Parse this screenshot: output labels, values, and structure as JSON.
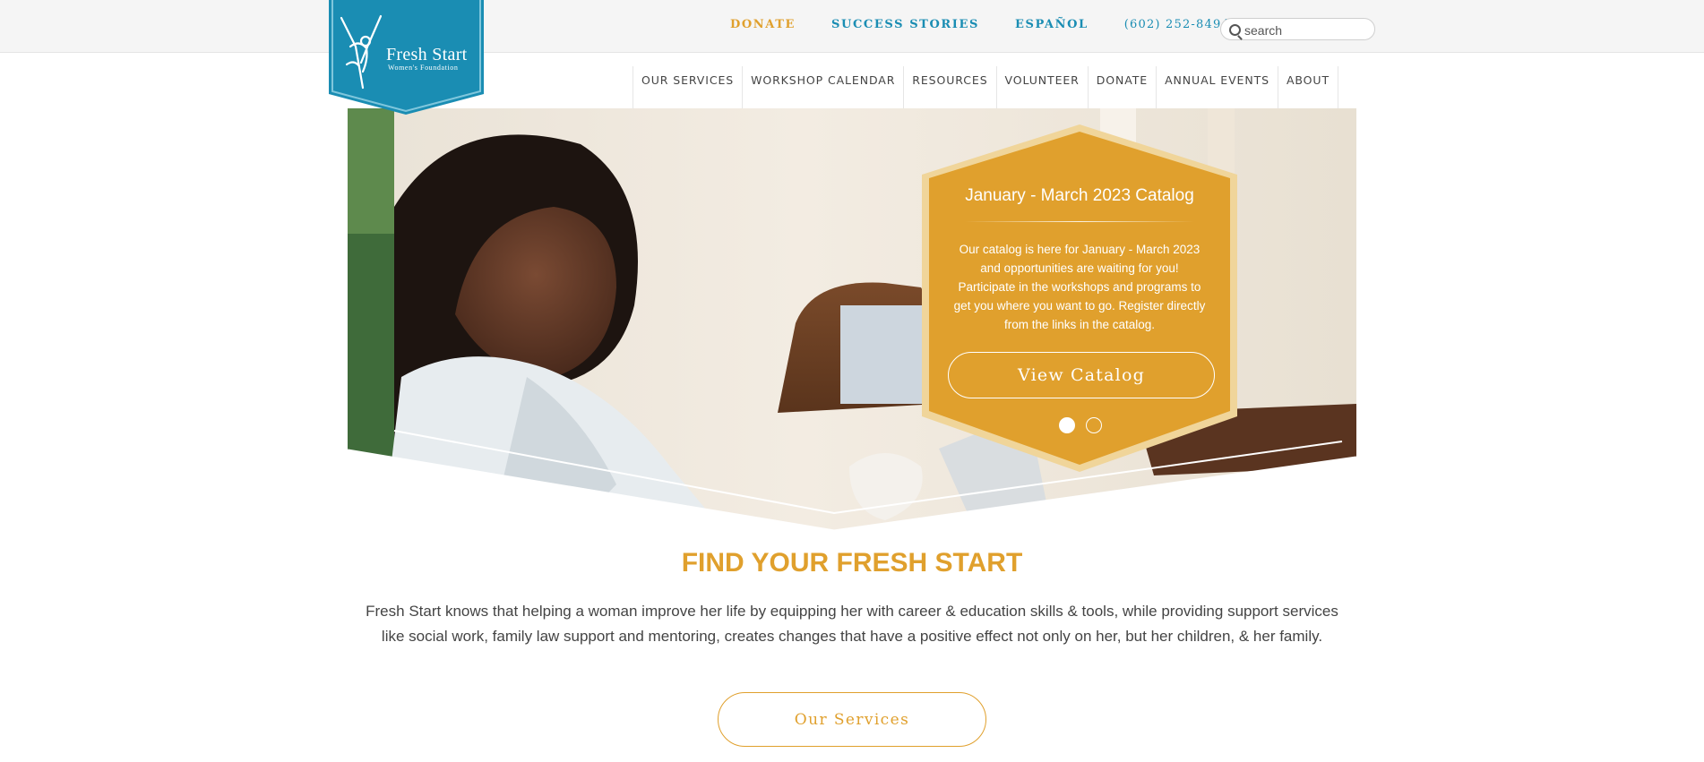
{
  "brand": {
    "name": "Fresh Start",
    "subtitle": "Women's Foundation",
    "colors": {
      "teal": "#1a8db3",
      "gold": "#e0a02d",
      "text": "#444444"
    }
  },
  "utility_nav": {
    "donate": "DONATE",
    "success_stories": "SUCCESS STORIES",
    "espanol": "ESPAÑOL",
    "phone": "(602) 252-8494"
  },
  "search": {
    "placeholder": "search",
    "icon": "search-icon"
  },
  "main_nav": {
    "items": [
      {
        "label": "OUR SERVICES"
      },
      {
        "label": "WORKSHOP CALENDAR"
      },
      {
        "label": "RESOURCES"
      },
      {
        "label": "VOLUNTEER"
      },
      {
        "label": "DONATE"
      },
      {
        "label": "ANNUAL EVENTS"
      },
      {
        "label": "ABOUT"
      }
    ]
  },
  "hero": {
    "title": "January - March 2023 Catalog",
    "text": "Our catalog is here for January - March 2023 and opportunities are waiting for you! Participate in the workshops and programs to get you where you want to go. Register directly from the links in the catalog.",
    "button": "View Catalog",
    "slides_total": 2,
    "active_slide": 1
  },
  "intro": {
    "heading": "FIND YOUR FRESH START",
    "text": "Fresh Start knows that helping a woman improve her life by equipping her with career & education skills & tools, while providing support services like social work, family law support and mentoring, creates changes that have a positive effect not only on her, but her children, & her family.",
    "button": "Our Services"
  }
}
